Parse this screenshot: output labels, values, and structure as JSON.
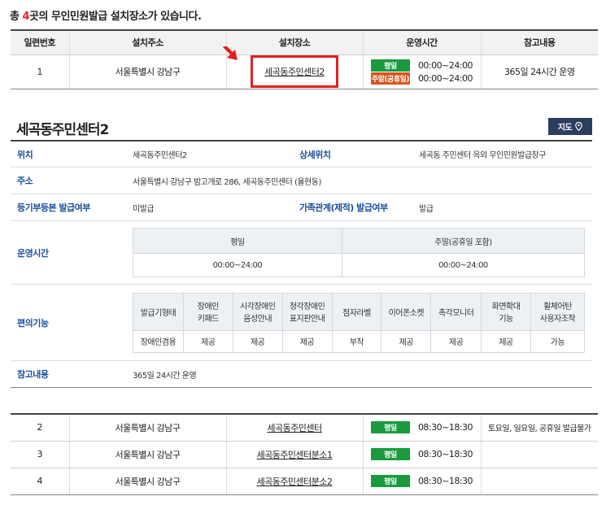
{
  "summary": {
    "prefix": "총 ",
    "count": "4",
    "suffix": "곳의 무인민원발급 설치장소가 있습니다."
  },
  "list": {
    "headers": [
      "일련번호",
      "설치주소",
      "설치장소",
      "운영시간",
      "참고내용"
    ],
    "first_row": {
      "no": "1",
      "address": "서울특별시 강남구",
      "place": "세곡동주민센터2",
      "weekday_badge": "평일",
      "weekday_hours": "00:00~24:00",
      "holiday_badge": "주말(공휴일)",
      "holiday_hours": "00:00~24:00",
      "note": "365일 24시간 운영"
    }
  },
  "detail": {
    "title": "세곡동주민센터2",
    "map_button": "지도",
    "location_label": "위치",
    "location_value": "세곡동주민센터2",
    "detail_location_label": "상세위치",
    "detail_location_value": "세곡동 주민센터 옥외 무인민원발급창구",
    "address_label": "주소",
    "address_value": "서울특별시 강남구 밤고개로 286, 세곡동주민센터 (율현동)",
    "registry_label": "등기부등본 발급여부",
    "registry_value": "미발급",
    "family_label": "가족관계(제적) 발급여부",
    "family_value": "발급",
    "hours_label": "운영시간",
    "hours_headers": [
      "평일",
      "주말(공휴일 포함)"
    ],
    "hours_values": [
      "00:00~24:00",
      "00:00~24:00"
    ],
    "convenience_label": "편의기능",
    "conv_headers": [
      "발급기형태",
      "장애인\n키패드",
      "시각장애인\n음성안내",
      "청각장애인\n표지판안내",
      "점자라벨",
      "이어폰소켓",
      "촉각모니터",
      "화면확대\n기능",
      "휠체어탄\n사용자조작"
    ],
    "conv_values": [
      "장애인겸용",
      "제공",
      "제공",
      "제공",
      "부착",
      "제공",
      "제공",
      "제공",
      "가능"
    ],
    "note_label": "참고내용",
    "note_value": "365일 24시간 운영"
  },
  "rows": [
    {
      "no": "2",
      "address": "서울특별시 강남구",
      "place": "세곡동주민센터",
      "badge": "평일",
      "hours": "08:30~18:30",
      "note": "토요일, 일요일, 공휴일 발급불가"
    },
    {
      "no": "3",
      "address": "서울특별시 강남구",
      "place": "세곡동주민센터분소1",
      "badge": "평일",
      "hours": "08:30~18:30",
      "note": ""
    },
    {
      "no": "4",
      "address": "서울특별시 강남구",
      "place": "세곡동주민센터분소2",
      "badge": "평일",
      "hours": "08:30~18:30",
      "note": ""
    }
  ],
  "colors": {
    "accent": "#e0262b",
    "label_blue": "#1d4ea0",
    "badge_green": "#1a9a3e",
    "badge_orange": "#d9541e",
    "map_button": "#2c3e5e"
  }
}
